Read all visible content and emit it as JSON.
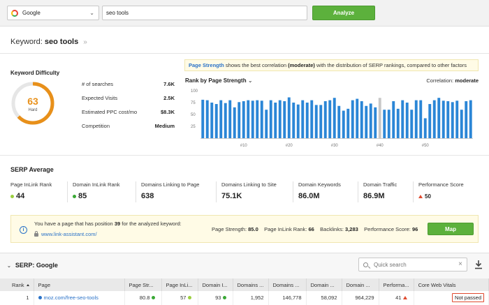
{
  "search": {
    "engine": "Google",
    "query": "seo tools",
    "analyze_label": "Analyze"
  },
  "keyword": {
    "label": "Keyword:",
    "value": "seo tools"
  },
  "difficulty": {
    "title": "Keyword Difficulty",
    "score": "63",
    "score_value": 63,
    "level": "Hard",
    "gauge_color": "#e8901a",
    "stats": [
      {
        "label": "# of searches",
        "value": "7.6K"
      },
      {
        "label": "Expected Visits",
        "value": "2.5K"
      },
      {
        "label": "Estimated PPC cost/mo",
        "value": "$8.3K"
      },
      {
        "label": "Competition",
        "value": "Medium"
      }
    ]
  },
  "page_strength_note": {
    "link": "Page Strength",
    "pre": " shows the best correlation ",
    "bold": "(moderate)",
    "post": " with the distribution of SERP rankings, compared to other factors"
  },
  "chart_header": {
    "rank_by": "Rank by Page Strength",
    "correlation_label": "Correlation:",
    "correlation_value": "moderate"
  },
  "chart_data": {
    "type": "bar",
    "title": "",
    "xlabel": "",
    "ylabel": "",
    "ylim": [
      0,
      100
    ],
    "y_ticks": [
      0,
      25,
      50,
      75,
      100
    ],
    "x_ticks": [
      "#10",
      "#20",
      "#30",
      "#40",
      "#50"
    ],
    "bar_color": "#2b86d6",
    "highlight_color": "#c8c8c8",
    "highlight_index": 39,
    "values": [
      81,
      80,
      75,
      72,
      80,
      74,
      80,
      65,
      76,
      78,
      80,
      79,
      80,
      79,
      60,
      80,
      75,
      80,
      78,
      86,
      75,
      71,
      80,
      75,
      80,
      70,
      70,
      78,
      80,
      85,
      68,
      58,
      62,
      80,
      83,
      78,
      68,
      73,
      65,
      85,
      60,
      60,
      78,
      62,
      80,
      75,
      60,
      80,
      80,
      42,
      72,
      80,
      85,
      79,
      78,
      76,
      79,
      60,
      78,
      80
    ]
  },
  "serp_average": {
    "title": "SERP Average",
    "metrics": [
      {
        "label": "Page InLink Rank",
        "value": "44",
        "indicator": "dot",
        "color": "#9bcf3f"
      },
      {
        "label": "Domain InLink Rank",
        "value": "85",
        "indicator": "dot",
        "color": "#3aa835"
      },
      {
        "label": "Domains Linking to Page",
        "value": "638",
        "indicator": "none"
      },
      {
        "label": "Domains Linking to Site",
        "value": "75.1K",
        "indicator": "none"
      },
      {
        "label": "Domain Keywords",
        "value": "86.0M",
        "indicator": "none"
      },
      {
        "label": "Domain Traffic",
        "value": "86.9M",
        "indicator": "none"
      },
      {
        "label": "Performance Score",
        "value": "50",
        "indicator": "triangle",
        "color": "#e04a2f"
      }
    ]
  },
  "notice": {
    "text_pre": "You have a page that has position ",
    "position": "39",
    "text_post": " for the analyzed keyword:",
    "url": "www.link-assistant.com/",
    "stats": [
      {
        "label": "Page Strength:",
        "value": "85.0"
      },
      {
        "label": "Page InLink Rank:",
        "value": "66"
      },
      {
        "label": "Backlinks:",
        "value": "3,283"
      },
      {
        "label": "Performance Score:",
        "value": "96"
      }
    ],
    "map_label": "Map"
  },
  "serp": {
    "title": "SERP: Google",
    "search_placeholder": "Quick search",
    "columns": [
      "Rank",
      "Page",
      "Page Str...",
      "Page InLi...",
      "Domain I...",
      "Domains ...",
      "Domains ...",
      "Domain ...",
      "Domain ...",
      "Performa...",
      "Core Web Vitals"
    ],
    "rows": [
      {
        "rank": "1",
        "page": "moz.com/free-seo-tools",
        "page_strength": "80.8",
        "page_inlink": "57",
        "domain_inlink": "93",
        "domains_page": "1,952",
        "domains_site": "146,778",
        "domain_keywords": "58,092",
        "domain_traffic": "964,229",
        "performance": "41",
        "cwv": "Not passed"
      }
    ]
  }
}
